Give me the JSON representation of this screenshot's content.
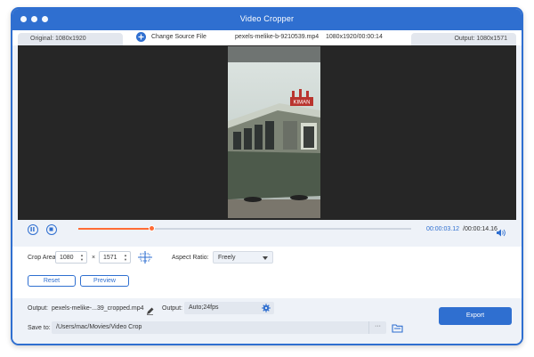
{
  "window": {
    "title": "Video Cropper",
    "accent_color": "#2f6fd0",
    "progress_color": "#ff6b35"
  },
  "infobar": {
    "original": "Original: 1080x1920",
    "change_source": "Change Source File",
    "file_name": "pexels-melike-b-9210539.mp4",
    "file_meta": "1080x1920/00:00:14",
    "output": "Output: 1080x1571"
  },
  "preview": {
    "sign_text": "KIMAN"
  },
  "playback": {
    "current_time": "00:00:03.12",
    "total_time": "/00:00:14.16",
    "progress": 0.22
  },
  "crop": {
    "area_label": "Crop Area:",
    "width": "1080",
    "times": "×",
    "height": "1571",
    "aspect_label": "Aspect Ratio:",
    "aspect_value": "Freely",
    "reset_label": "Reset",
    "preview_label": "Preview"
  },
  "output": {
    "label": "Output:",
    "file": "pexels-melike-...39_cropped.mp4",
    "format_label": "Output:",
    "format_value": "Auto;24fps",
    "save_label": "Save to:",
    "save_path": "/Users/mac/Movies/Video Crop",
    "browse": "···",
    "export_label": "Export"
  }
}
